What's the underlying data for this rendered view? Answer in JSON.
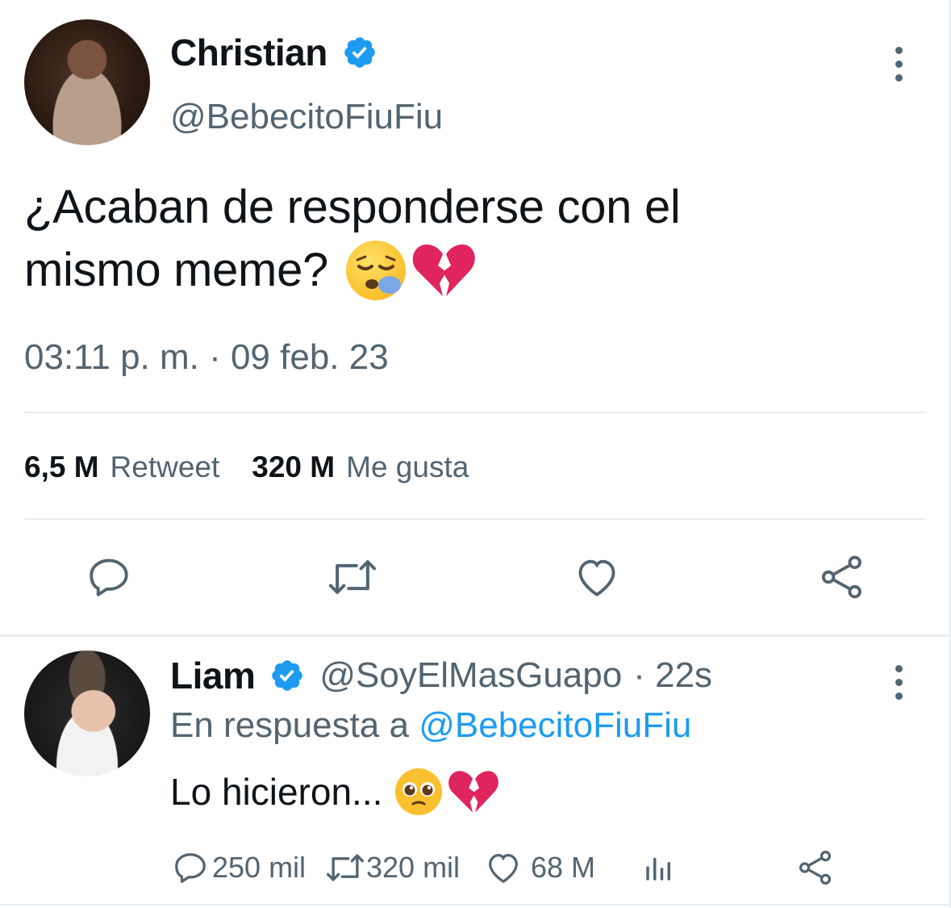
{
  "main_tweet": {
    "author_name": "Christian",
    "author_handle": "@BebecitoFiuFiu",
    "text_line1": "¿Acaban de responderse con el",
    "text_line2": "mismo meme?",
    "timestamp": "03:11 p. m. · 09 feb. 23",
    "retweet_count": "6,5 M",
    "retweet_label": "Retweet",
    "like_count": "320 M",
    "like_label": "Me gusta"
  },
  "reply": {
    "author_name": "Liam",
    "author_handle": "@SoyElMasGuapo",
    "time": "· 22s",
    "reply_prefix": "En respuesta a",
    "reply_to": "@BebecitoFiuFiu",
    "text": "Lo hicieron...",
    "reply_count": "250 mil",
    "retweet_count": "320 mil",
    "like_count": "68 M"
  },
  "icons": {
    "reply": "reply-icon",
    "retweet": "retweet-icon",
    "like": "heart-icon",
    "share": "share-icon",
    "analytics": "analytics-icon",
    "more": "more-options-icon",
    "verified": "verified-badge-icon"
  },
  "colors": {
    "verified": "#1d9bf0",
    "link": "#1d9bf0",
    "secondary_text": "#536471",
    "divider": "#e6ecf0"
  }
}
